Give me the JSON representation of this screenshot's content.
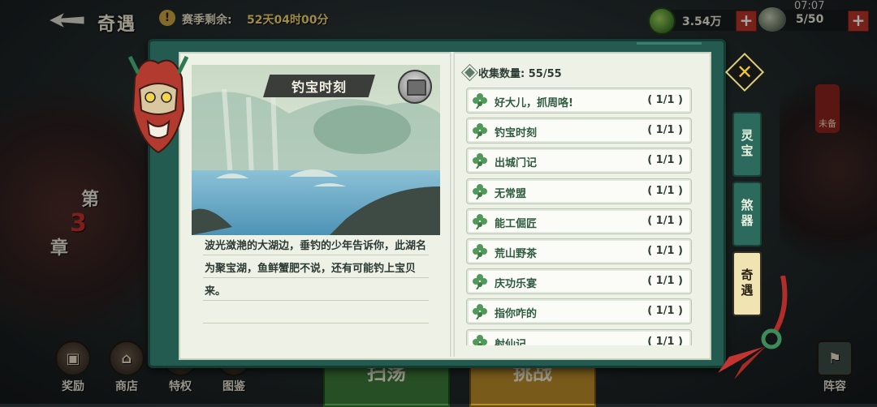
{
  "topbar": {
    "title": "奇遇",
    "season_label": "赛季剩余:",
    "season_value": "52天04时00分",
    "jade_amount": "3.54万",
    "stamina": "5/50",
    "clock": "07:07"
  },
  "left_panel": {
    "chapter_a": "第",
    "chapter_b": "3",
    "chapter_c": "章"
  },
  "right_badge": "未备",
  "bottom_nav": {
    "reward": "奖励",
    "shop": "商店",
    "privilege": "特权",
    "codex": "图鉴",
    "sweep": "扫荡",
    "challenge": "挑战",
    "lineup": "阵容"
  },
  "detail": {
    "title": "钓宝时刻",
    "description": "波光潋滟的大湖边，垂钓的少年告诉你，此湖名为聚宝湖，鱼鲜蟹肥不说，还有可能钓上宝贝来。"
  },
  "collection": {
    "count_label": "收集数量: 55/55",
    "items": [
      {
        "name": "好大儿，抓周咯!",
        "count": "( 1/1 )"
      },
      {
        "name": "钓宝时刻",
        "count": "( 1/1 )"
      },
      {
        "name": "出城门记",
        "count": "( 1/1 )"
      },
      {
        "name": "无常盟",
        "count": "( 1/1 )"
      },
      {
        "name": "能工倔匠",
        "count": "( 1/1 )"
      },
      {
        "name": "荒山野茶",
        "count": "( 1/1 )"
      },
      {
        "name": "庆功乐宴",
        "count": "( 1/1 )"
      },
      {
        "name": "指你咋的",
        "count": "( 1/1 )"
      },
      {
        "name": "射仙记",
        "count": "( 1/1 )"
      }
    ]
  },
  "tabs": {
    "t1": "灵宝",
    "t2": "煞器",
    "t3": "奇遇"
  },
  "colors": {
    "frame": "#235b51",
    "page": "#eef1e6",
    "accent_gold": "#f0c832",
    "item_text": "#2e5a3e"
  }
}
